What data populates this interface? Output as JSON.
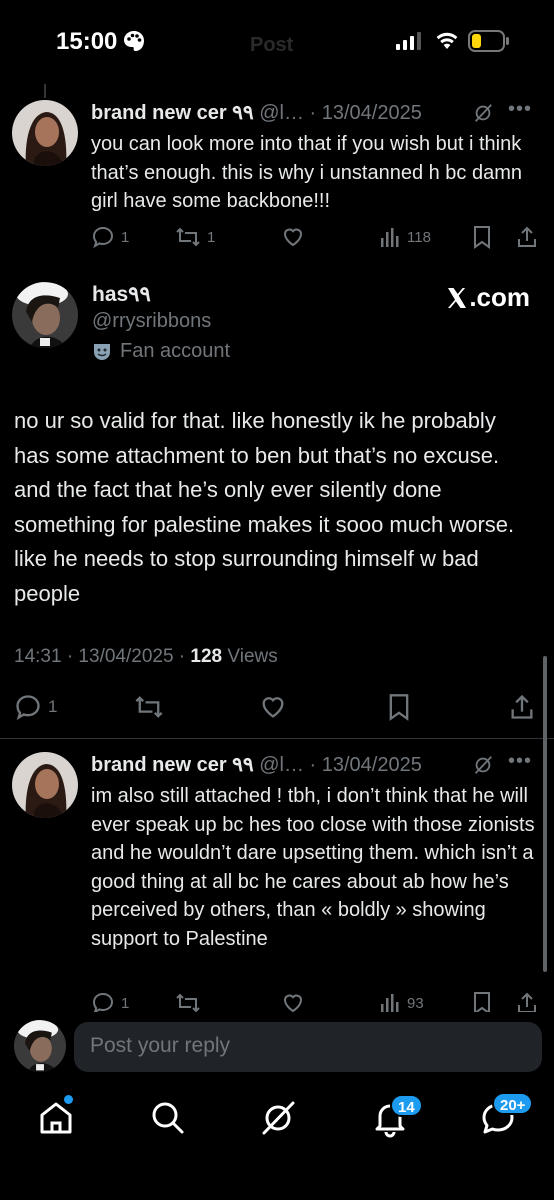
{
  "status_bar": {
    "time": "15:00",
    "faded_title": "Post"
  },
  "reply1": {
    "name": "brand new cer ٩٩",
    "handle": "@l…",
    "date": "· 13/04/2025",
    "text": "you can look more into that if you wish but i think that’s enough. this is why i unstanned h bc damn girl have some backbone!!!",
    "replies": "1",
    "reposts": "1",
    "views": "118"
  },
  "main_post": {
    "name": "has٩٩",
    "handle": "@rrysribbons",
    "label": "Fan account",
    "source": ".com",
    "text": "no ur so valid for that. like honestly ik he probably has some attachment to ben but that’s no excuse. and the fact that he’s only ever silently done something for palestine makes it sooo much worse. like he needs to stop surrounding himself w bad people",
    "time_date": "14:31 · 13/04/2025 · ",
    "views_count": "128",
    "views_label": " Views",
    "replies": "1"
  },
  "reply2": {
    "name": "brand new cer ٩٩",
    "handle": "@l…",
    "date": "· 13/04/2025",
    "text": "im also still attached ! tbh, i don’t think that he will ever speak up bc hes too close with those zionists and he wouldn’t dare upsetting them. which isn’t a good thing at all bc he cares about ab how he’s perceived by others, than « boldly » showing support to Palestine",
    "replies": "1",
    "views": "93"
  },
  "composer": {
    "placeholder": "Post your reply"
  },
  "tabbar": {
    "notifications_badge": "14",
    "messages_badge": "20+"
  },
  "colors": {
    "accent": "#1d9bf0",
    "background": "#000000",
    "muted": "#71767b",
    "text": "#e7e9ea"
  }
}
